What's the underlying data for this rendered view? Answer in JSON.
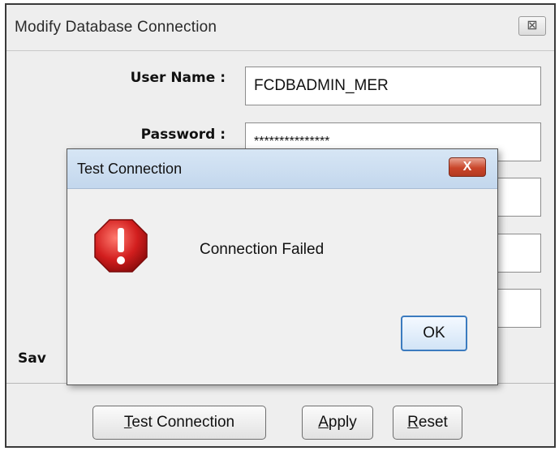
{
  "main_window": {
    "title": "Modify  Database Connection",
    "close_symbol": "⊠",
    "form": {
      "user_name_label": "User Name :",
      "user_name_value": "FCDBADMIN_MER",
      "password_label": "Password :",
      "password_value": "***************",
      "save_label_partial": "Sav"
    },
    "buttons": {
      "test_connection": "est Connection",
      "test_connection_mnemonic": "T",
      "apply": "pply",
      "apply_mnemonic": "A",
      "reset": "eset",
      "reset_mnemonic": "R"
    }
  },
  "dialog": {
    "title": "Test Connection",
    "close_symbol": "X",
    "icon": "error-stop-icon",
    "message": "Connection Failed",
    "ok_label": "OK"
  },
  "colors": {
    "dialog_title_bg": "#c9dcef",
    "close_red": "#c9452a",
    "error_icon_red": "#d21e1e"
  }
}
